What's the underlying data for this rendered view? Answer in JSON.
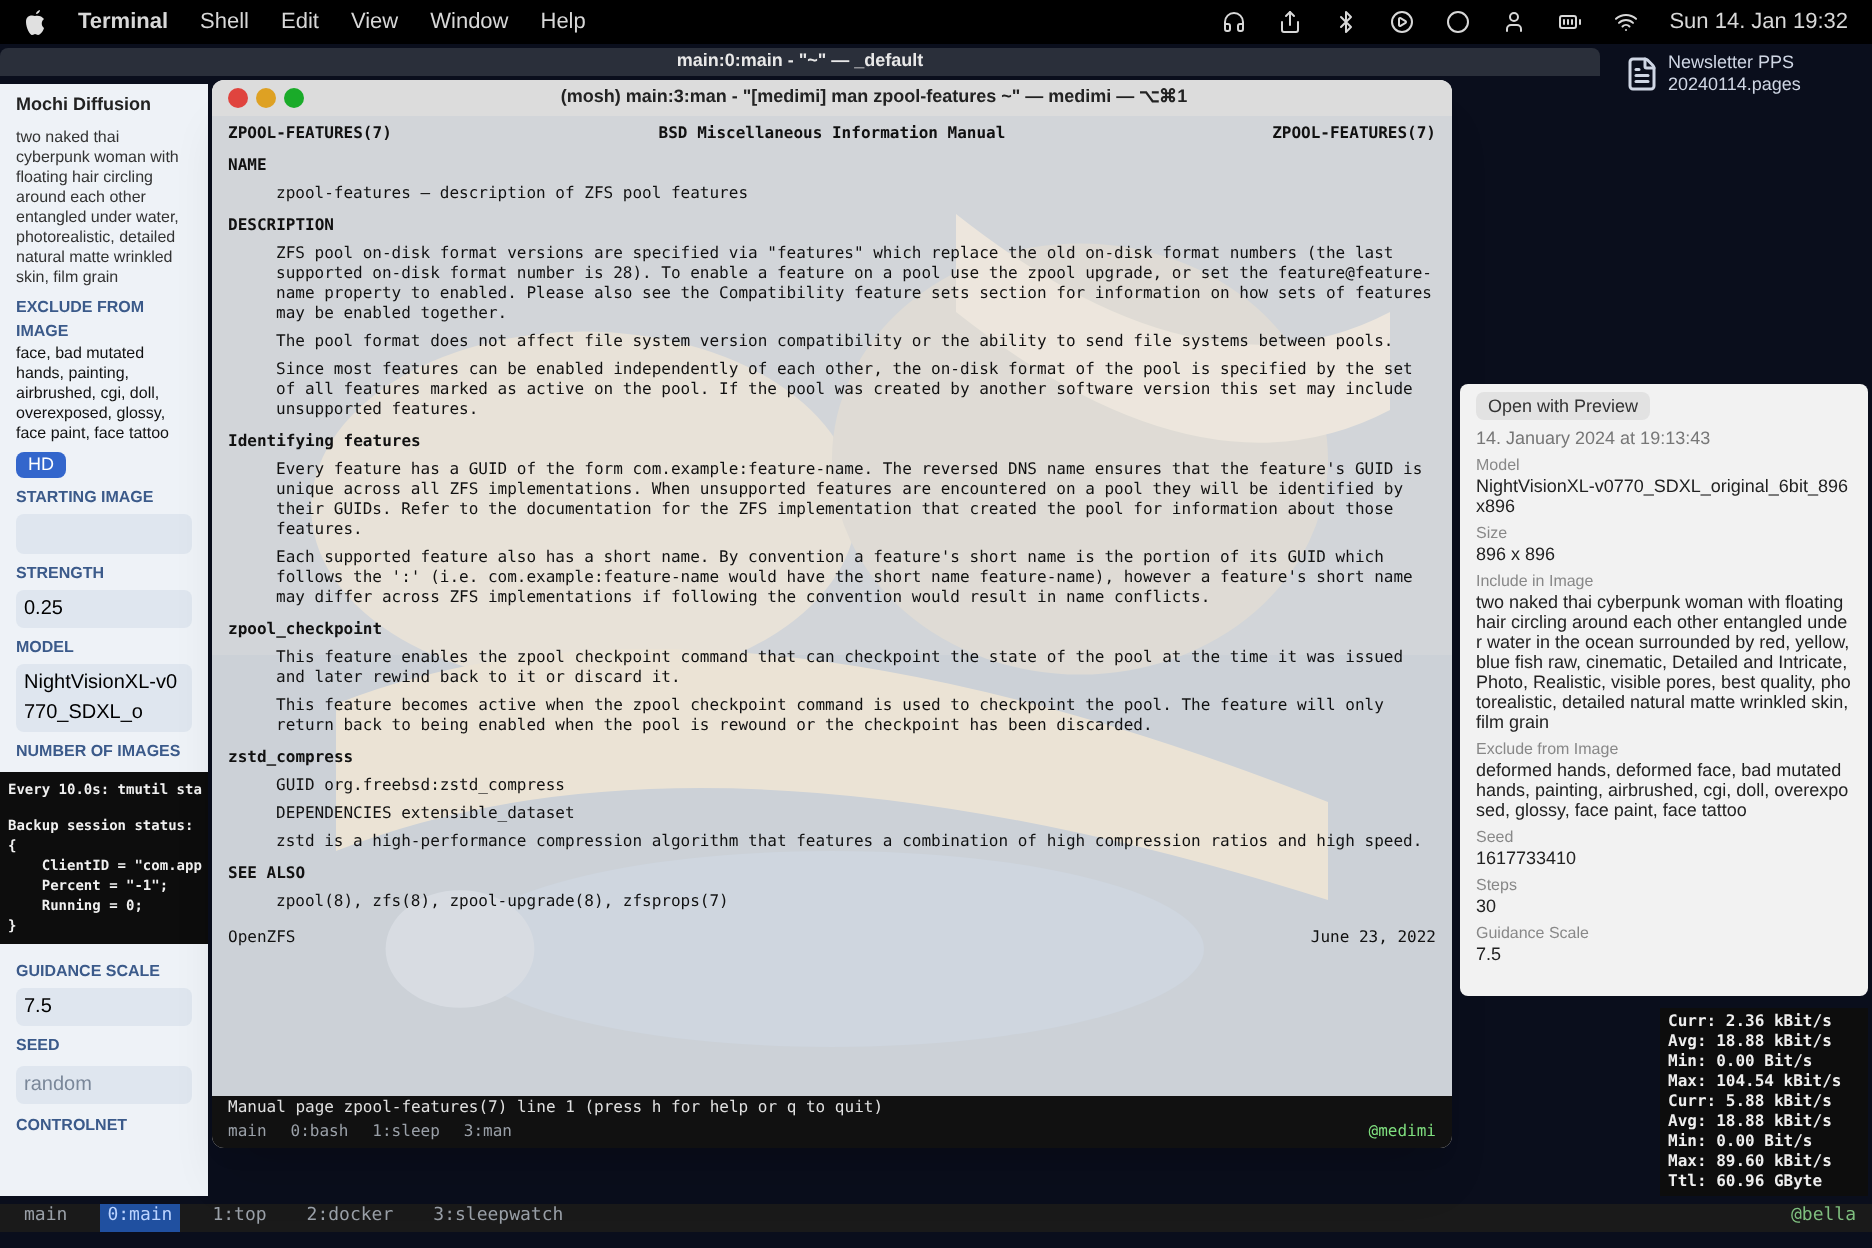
{
  "menu_bar": {
    "menus": [
      "Terminal",
      "Shell",
      "Edit",
      "View",
      "Window",
      "Help"
    ],
    "clock": "Sun 14. Jan 19:32"
  },
  "desktop_file": {
    "name": "Newsletter PPS",
    "subtitle": "20240114.pages"
  },
  "back_window": {
    "title": "main:0:main - \"~\" — _default"
  },
  "mochi": {
    "title": "Mochi Diffusion",
    "prompt": "two naked thai cyberpunk woman with floating hair circling around each other entangled under water, photorealistic, detailed natural matte wrinkled skin, film grain",
    "exclude_label": "EXCLUDE FROM IMAGE",
    "exclude_text": "face, bad mutated hands, painting, airbrushed, cgi, doll, overexposed, glossy, face paint, face tattoo",
    "hd_label": "HD",
    "fields": [
      {
        "kind": "picker",
        "label": "STARTING IMAGE"
      },
      {
        "kind": "value",
        "label": "STRENGTH",
        "value": "0.25"
      },
      {
        "kind": "value",
        "label": "MODEL",
        "value": "NightVisionXL-v0770_SDXL_o"
      },
      {
        "kind": "label",
        "label": "NUMBER OF IMAGES"
      },
      {
        "kind": "output"
      },
      {
        "kind": "value",
        "label": "GUIDANCE SCALE",
        "value": "7.5"
      },
      {
        "kind": "input",
        "label": "SEED",
        "placeholder": "random"
      },
      {
        "kind": "label",
        "label": "CONTROLNET"
      }
    ]
  },
  "tmutil": {
    "lines": [
      "Every 10.0s: tmutil sta",
      "Backup session status:",
      "{",
      "    ClientID = \"com.app",
      "    Percent = \"-1\";",
      "    Running = 0;",
      "}"
    ]
  },
  "terminal": {
    "title": "(mosh) main:3:man - \"[medimi] man zpool-features ~\" — medimi — ⌥⌘1",
    "header": [
      "ZPOOL-FEATURES(7)",
      "BSD Miscellaneous Information Manual",
      "ZPOOL-FEATURES(7)"
    ],
    "sections": [
      {
        "heading": "NAME",
        "paragraphs": [
          "zpool-features — description of ZFS pool features"
        ]
      },
      {
        "heading": "DESCRIPTION",
        "paragraphs": [
          "ZFS pool on-disk format versions are specified via \"features\" which replace the old on-disk format numbers (the last supported on-disk format number is 28). To enable a feature on a pool use the zpool upgrade, or set the feature@feature-name property to enabled. Please also see the Compatibility feature sets section for information on how sets of features may be enabled together.",
          "The pool format does not affect file system version compatibility or the ability to send file systems between pools.",
          "Since most features can be enabled independently of each other, the on-disk format of the pool is specified by the set of all features marked as active on the pool. If the pool was created by another software version this set may include unsupported features."
        ]
      },
      {
        "heading": "Identifying features",
        "paragraphs": [
          "Every feature has a GUID of the form com.example:feature-name. The reversed DNS name ensures that the feature's GUID is unique across all ZFS implementations. When unsupported features are encountered on a pool they will be identified by their GUIDs. Refer to the documentation for the ZFS implementation that created the pool for information about those features.",
          "Each supported feature also has a short name. By convention a feature's short name is the portion of its GUID which follows the ':' (i.e. com.example:feature-name would have the short name feature-name), however a feature's short name may differ across ZFS implementations if following the convention would result in name conflicts."
        ]
      },
      {
        "heading": "zpool_checkpoint",
        "paragraphs": [
          "This feature enables the zpool checkpoint command that can checkpoint the state of the pool at the time it was issued and later rewind back to it or discard it.",
          "This feature becomes active when the zpool checkpoint command is used to checkpoint the pool. The feature will only return back to being enabled when the pool is rewound or the checkpoint has been discarded."
        ]
      },
      {
        "heading": "zstd_compress",
        "paragraphs": [
          "GUID org.freebsd:zstd_compress",
          "DEPENDENCIES extensible_dataset",
          "zstd is a high-performance compression algorithm that features a combination of high compression ratios and high speed."
        ]
      },
      {
        "heading": "SEE ALSO",
        "paragraphs": [
          "zpool(8), zfs(8), zpool-upgrade(8), zfsprops(7)"
        ]
      }
    ],
    "footer": [
      "OpenZFS",
      "June 23, 2022"
    ],
    "pager": "Manual page zpool-features(7) line 1 (press h for help or q to quit)",
    "status_left": [
      "main",
      "0:bash",
      "1:sleep",
      "3:man"
    ],
    "status_right": "@medimi"
  },
  "info_panel": {
    "open_button": "Open with Preview",
    "date": "14. January 2024 at 19:13:43",
    "fields": [
      {
        "label": "Model",
        "value": "NightVisionXL-v0770_SDXL_original_6bit_896x896"
      },
      {
        "label": "Size",
        "value": "896 x 896"
      },
      {
        "label": "Include in Image",
        "value": "two naked thai cyberpunk woman with floating hair circling around each other entangled under water in the ocean surrounded by red, yellow, blue fish raw, cinematic, Detailed and Intricate, Photo, Realistic, visible pores, best quality, photorealistic, detailed natural matte wrinkled skin, film grain"
      },
      {
        "label": "Exclude from Image",
        "value": "deformed hands, deformed face, bad mutated hands, painting, airbrushed, cgi, doll, overexposed, glossy, face paint, face tattoo"
      },
      {
        "label": "Seed",
        "value": "1617733410"
      },
      {
        "label": "Steps",
        "value": "30"
      },
      {
        "label": "Guidance Scale",
        "value": "7.5"
      }
    ]
  },
  "nload": {
    "lines": [
      "Curr: 2.36 kBit/s",
      "Avg: 18.88 kBit/s",
      "Min: 0.00 Bit/s",
      "Max: 104.54 kBit/s",
      "Curr: 5.88 kBit/s",
      "Avg: 18.88 kBit/s",
      "Min: 0.00 Bit/s",
      "Max: 89.60 kBit/s",
      "Ttl: 60.96 GByte"
    ]
  },
  "tmux_bar": {
    "windows": [
      {
        "label": "main",
        "selected": false
      },
      {
        "label": "0:main",
        "selected": true
      },
      {
        "label": "1:top",
        "selected": false
      },
      {
        "label": "2:docker",
        "selected": false
      },
      {
        "label": "3:sleepwatch",
        "selected": false
      }
    ],
    "right": "@bella"
  }
}
